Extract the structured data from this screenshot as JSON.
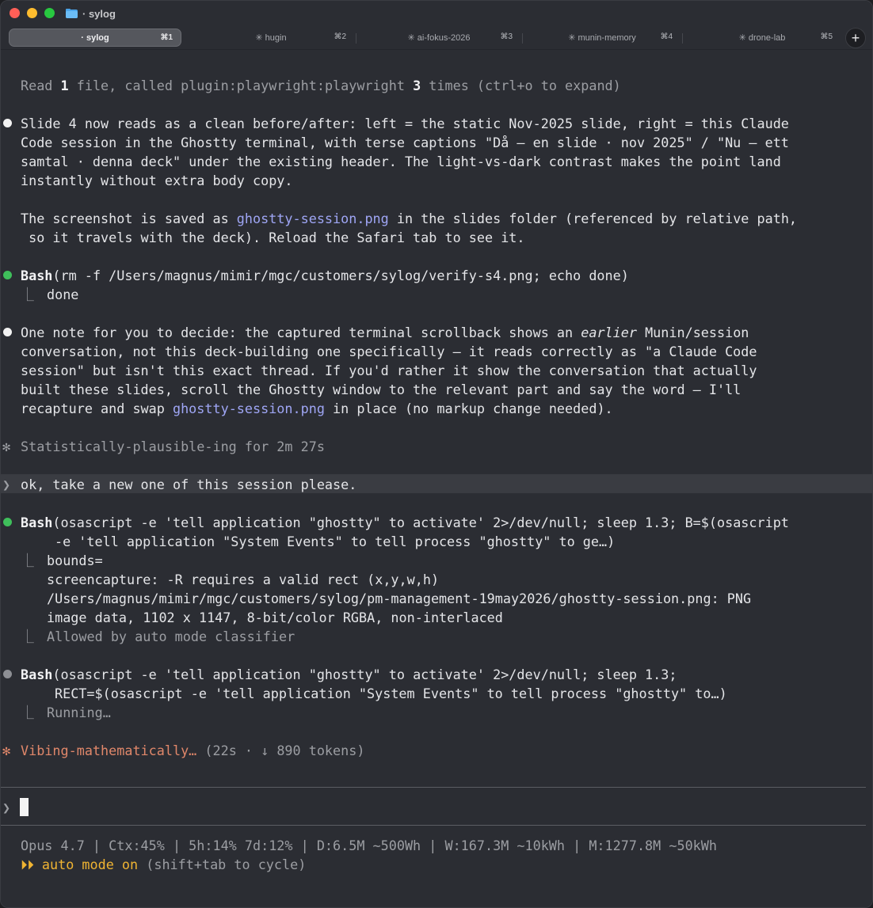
{
  "window": {
    "title": "· sylog"
  },
  "tabs": [
    {
      "label": "· sylog",
      "shortcut": "⌘1",
      "active": true
    },
    {
      "label": "✳ hugin",
      "shortcut": "⌘2",
      "active": false
    },
    {
      "label": "✳ ai-fokus-2026",
      "shortcut": "⌘3",
      "active": false
    },
    {
      "label": "✳ munin-memory",
      "shortcut": "⌘4",
      "active": false
    },
    {
      "label": "✳ drone-lab",
      "shortcut": "⌘5",
      "active": false
    }
  ],
  "new_tab_label": "+",
  "transcript": {
    "read_line": {
      "a": "Read ",
      "n1": "1",
      "b": " file, called plugin:playwright:playwright ",
      "n2": "3",
      "c": " times (ctrl+o to expand)"
    },
    "msg1": [
      "Slide 4 now reads as a clean before/after: left = the static Nov-2025 slide, right = this Claude",
      "Code session in the Ghostty terminal, with terse captions \"Då — en slide · nov 2025\" / \"Nu — ett",
      "samtal · denna deck\" under the existing header. The light-vs-dark contrast makes the point land",
      "instantly without extra body copy."
    ],
    "msg2": {
      "a": "The screenshot is saved as ",
      "link": "ghostty-session.png",
      "b": " in the slides folder (referenced by relative path,",
      "line2": " so it travels with the deck). Reload the Safari tab to see it."
    },
    "bash1": {
      "tool": "Bash",
      "cmd": "(rm -f /Users/magnus/mimir/mgc/customers/sylog/verify-s4.png; echo done)",
      "corner": "⎿",
      "output": "done"
    },
    "msg3": {
      "l1a": "One note for you to decide: the captured terminal scrollback shows an ",
      "l1i": "earlier",
      "l1b": " Munin/session",
      "l2": "conversation, not this deck-building one specifically — it reads correctly as \"a Claude Code",
      "l3": "session\" but isn't this exact thread. If you'd rather it show the conversation that actually",
      "l4": "built these slides, scroll the Ghostty window to the relevant part and say the word — I'll",
      "l5a": "recapture and swap ",
      "l5link": "ghostty-session.png",
      "l5b": " in place (no markup change needed)."
    },
    "status1": {
      "glyph": "✻",
      "text": "Statistically-plausible-ing for 2m 27s"
    },
    "user": {
      "prompt": "❯",
      "text": "ok, take a new one of this session please."
    },
    "bash2": {
      "tool": "Bash",
      "cmd1": "(osascript -e 'tell application \"ghostty\" to activate' 2>/dev/null; sleep 1.3; B=$(osascript",
      "cmd2": "-e 'tell application \"System Events\" to tell process \"ghostty\" to ge…)",
      "corner": "⎿",
      "out1": "bounds=",
      "out2": "screencapture: -R requires a valid rect (x,y,w,h)",
      "out3": "/Users/magnus/mimir/mgc/customers/sylog/pm-management-19may2026/ghostty-session.png: PNG",
      "out4": "image data, 1102 x 1147, 8-bit/color RGBA, non-interlaced",
      "out5": "Allowed by auto mode classifier"
    },
    "bash3": {
      "tool": "Bash",
      "cmd1": "(osascript -e 'tell application \"ghostty\" to activate' 2>/dev/null; sleep 1.3;",
      "cmd2": "RECT=$(osascript -e 'tell application \"System Events\" to tell process \"ghostty\" to…)",
      "corner": "⎿",
      "out1": "Running…"
    },
    "status2": {
      "glyph": "✻",
      "main": "Vibing-mathematically…",
      "rest": " (22s · ↓ 890 tokens)"
    }
  },
  "input": {
    "prompt": "❯",
    "value": ""
  },
  "statusline": {
    "line1": "Opus 4.7 | Ctx:45% | 5h:14% 7d:12% | D:6.5M ~500Wh | W:167.3M ~10kWh | M:1277.8M ~50kWh",
    "mode_glyph": "⏵⏵",
    "mode": " auto mode on",
    "hint": " (shift+tab to cycle)"
  },
  "colors": {
    "background": "#2b2d33",
    "accent_orange": "#e0876a",
    "link": "#9fa6f5",
    "success": "#3fbf5b",
    "mode_yellow": "#f0b432"
  }
}
